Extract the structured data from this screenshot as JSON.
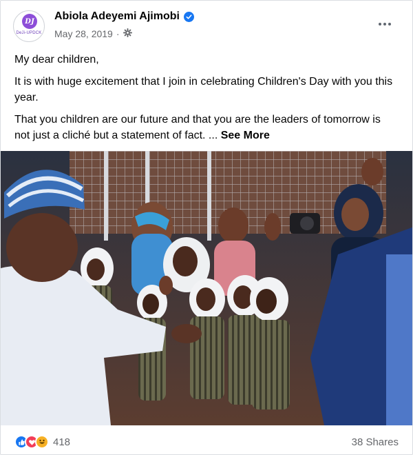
{
  "post": {
    "author": {
      "name": "Abiola Adeyemi Ajimobi",
      "avatar_initials": "DJ",
      "avatar_subtext": "DeJi-UPDCK",
      "verified": true
    },
    "date": "May 28, 2019",
    "separator": "·",
    "audience_icon": "gear-icon",
    "menu_icon": "more-dots-icon",
    "body": {
      "greeting": "My dear children,",
      "paragraph1": "It is with huge excitement that I join in celebrating Children's Day with you this year.",
      "paragraph2": "That you children are our future and that you are the leaders of tomorrow is not just a cliché but a statement of fact. ...",
      "see_more": "See More"
    },
    "photo": {
      "icon": "photo-children-day"
    },
    "reactions": {
      "types": [
        "like",
        "love",
        "haha"
      ],
      "count": "418"
    },
    "shares": "38 Shares"
  },
  "colors": {
    "brand_blue": "#1877f2",
    "love_red": "#f33e58",
    "haha_yellow": "#f7b125",
    "secondary_text": "#65676b"
  }
}
